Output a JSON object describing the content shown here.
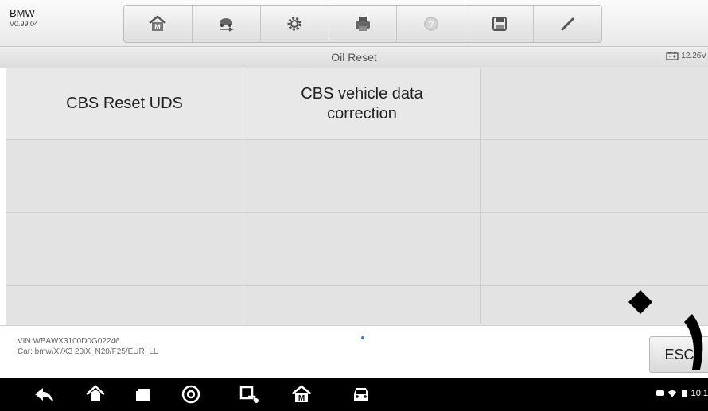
{
  "header": {
    "make": "BMW",
    "version": "V0.99.04",
    "toolbar": [
      {
        "icon": "home-icon"
      },
      {
        "icon": "vehicle-swap-icon"
      },
      {
        "icon": "settings-icon"
      },
      {
        "icon": "print-icon"
      },
      {
        "icon": "help-icon"
      },
      {
        "icon": "save-icon"
      },
      {
        "icon": "edit-icon"
      }
    ]
  },
  "titlebar": {
    "title": "Oil Reset",
    "battery_voltage": "12.26V"
  },
  "functions": [
    {
      "label": "CBS Reset UDS"
    },
    {
      "label": "CBS vehicle data\ncorrection"
    }
  ],
  "vehicle": {
    "vin": "VIN:WBAWX3100D0G02246",
    "car": "Car: bmw/X'/X3 20iX_N20/F25/EUR_LL"
  },
  "actions": {
    "esc_label": "ESC"
  },
  "system": {
    "clock": "10:1",
    "nav_icons": [
      "back-icon",
      "home-icon",
      "recent-apps-icon",
      "chrome-icon",
      "vci-connect-icon",
      "maxisys-home-icon",
      "vehicle-icon"
    ]
  },
  "colors": {
    "grid_cell": "#e3e3e3",
    "navbar": "#000000",
    "accent_dot": "#3c7fd1"
  }
}
